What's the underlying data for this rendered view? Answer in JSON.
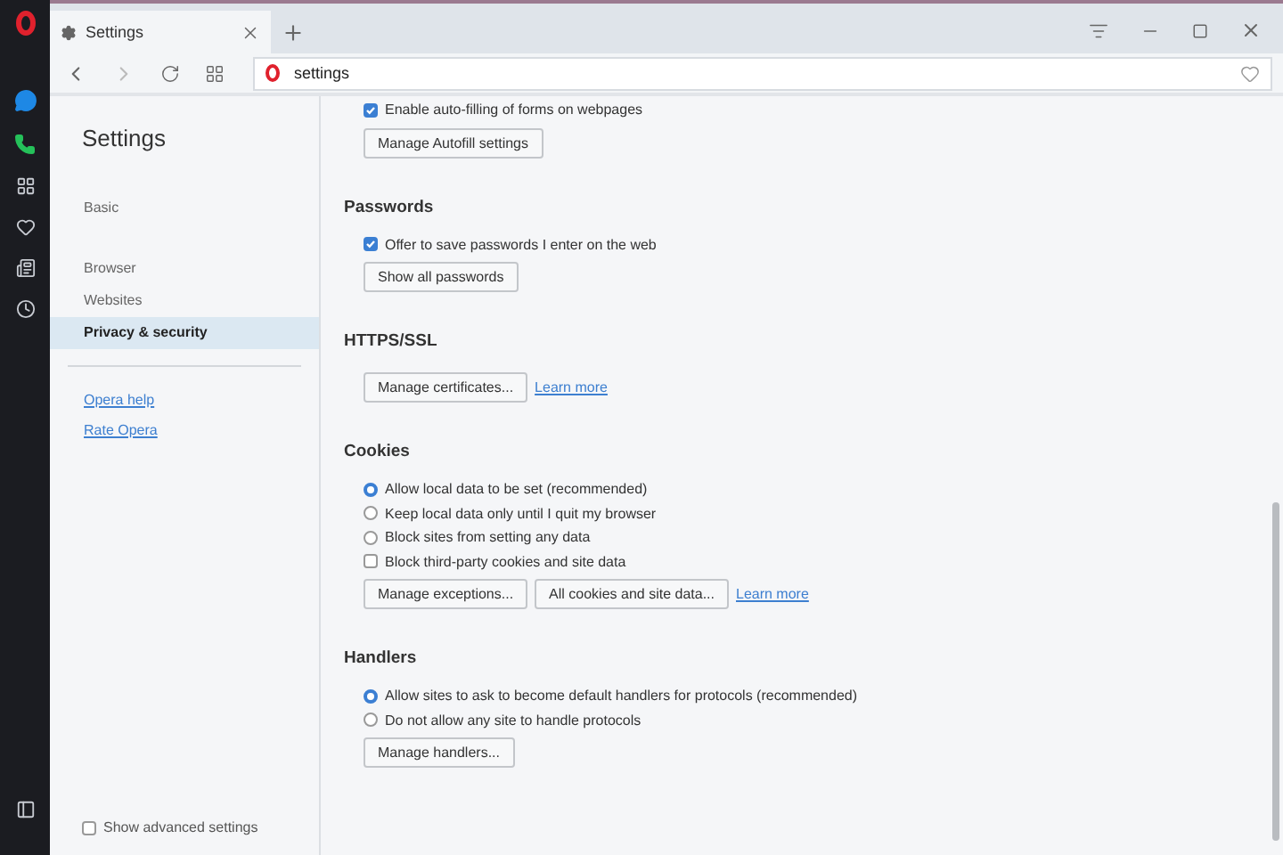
{
  "tab": {
    "title": "Settings",
    "selected": true
  },
  "address": {
    "value": "settings"
  },
  "nav": {
    "title": "Settings",
    "groups": [
      [
        {
          "label": "Basic",
          "selected": false
        }
      ],
      [
        {
          "label": "Browser",
          "selected": false
        },
        {
          "label": "Websites",
          "selected": false
        },
        {
          "label": "Privacy & security",
          "selected": true
        }
      ]
    ],
    "links": [
      "Opera help",
      "Rate Opera"
    ],
    "show_advanced": {
      "label": "Show advanced settings",
      "checked": false
    }
  },
  "sections": [
    {
      "items": [
        {
          "kind": "checkbox",
          "label": "Enable auto-filling of forms on webpages",
          "checked": true
        },
        {
          "kind": "buttons",
          "buttons": [
            {
              "kind": "button",
              "label": "Manage Autofill settings"
            }
          ]
        }
      ]
    },
    {
      "title": "Passwords",
      "items": [
        {
          "kind": "checkbox",
          "label": "Offer to save passwords I enter on the web",
          "checked": true
        },
        {
          "kind": "buttons",
          "buttons": [
            {
              "kind": "button",
              "label": "Show all passwords"
            }
          ]
        }
      ]
    },
    {
      "title": "HTTPS/SSL",
      "items": [
        {
          "kind": "buttons",
          "buttons": [
            {
              "kind": "button",
              "label": "Manage certificates..."
            },
            {
              "kind": "link",
              "label": "Learn more"
            }
          ]
        }
      ]
    },
    {
      "title": "Cookies",
      "items": [
        {
          "kind": "radio",
          "label": "Allow local data to be set (recommended)",
          "selected": true
        },
        {
          "kind": "radio",
          "label": "Keep local data only until I quit my browser",
          "selected": false
        },
        {
          "kind": "radio",
          "label": "Block sites from setting any data",
          "selected": false
        },
        {
          "kind": "checkbox",
          "label": "Block third-party cookies and site data",
          "checked": false
        },
        {
          "kind": "buttons",
          "buttons": [
            {
              "kind": "button",
              "label": "Manage exceptions..."
            },
            {
              "kind": "button",
              "label": "All cookies and site data..."
            },
            {
              "kind": "link",
              "label": "Learn more"
            }
          ]
        }
      ]
    },
    {
      "title": "Handlers",
      "items": [
        {
          "kind": "radio",
          "label": "Allow sites to ask to become default handlers for protocols (recommended)",
          "selected": true
        },
        {
          "kind": "radio",
          "label": "Do not allow any site to handle protocols",
          "selected": false
        },
        {
          "kind": "buttons",
          "buttons": [
            {
              "kind": "button",
              "label": "Manage handlers..."
            }
          ]
        }
      ]
    }
  ]
}
